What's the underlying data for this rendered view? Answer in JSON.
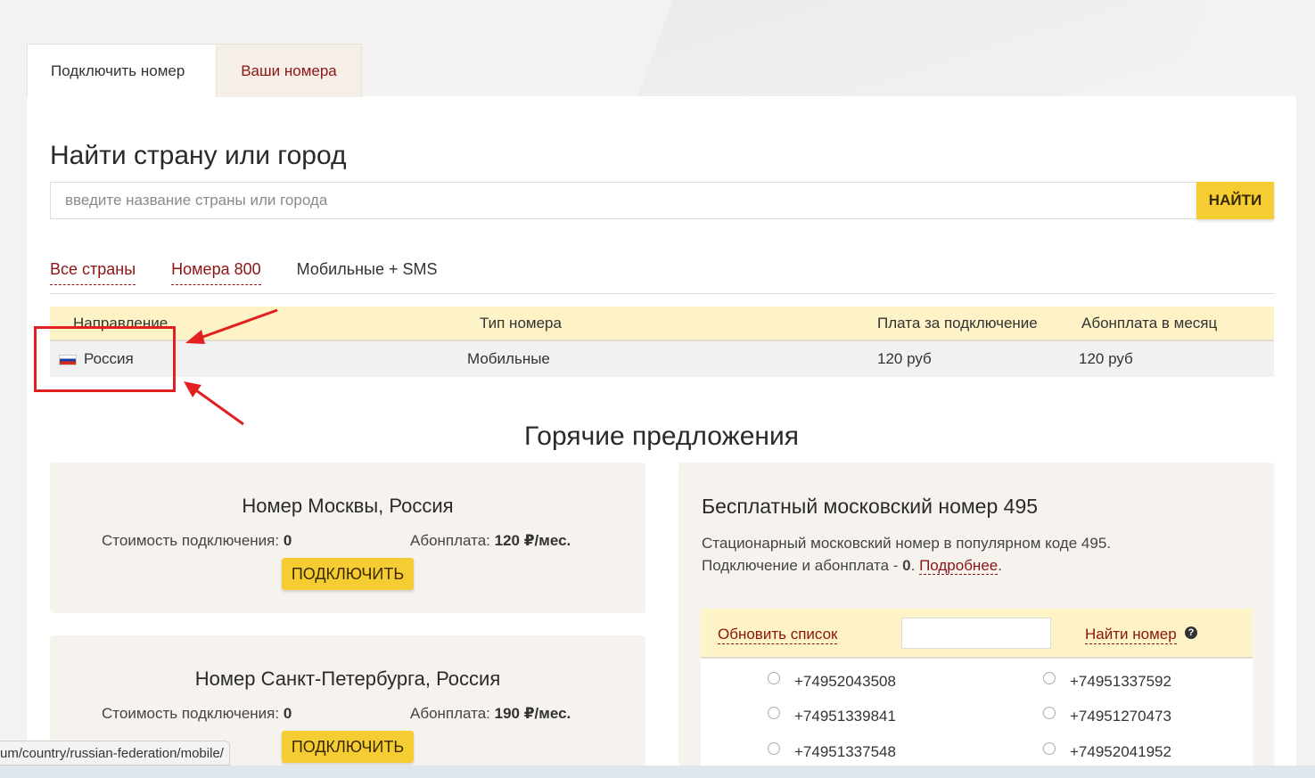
{
  "tabs": {
    "connect_label": "Подключить номер",
    "mine_label": "Ваши номера"
  },
  "search": {
    "title": "Найти страну или город",
    "placeholder": "введите название страны или города",
    "button_label": "НАЙТИ"
  },
  "subtabs": [
    "Все страны",
    "Номера 800",
    "Мобильные + SMS"
  ],
  "table": {
    "headers": [
      "Направление",
      "Тип номера",
      "Плата за подключение",
      "Абонплата в месяц"
    ],
    "rows": [
      {
        "direction": "Россия",
        "type": "Мобильные",
        "connect_fee": "120 руб",
        "monthly_fee": "120 руб"
      }
    ]
  },
  "hot": {
    "title": "Горячие предложения",
    "cards": [
      {
        "title": "Номер Москвы, Россия",
        "connect_label": "Стоимость подключения:",
        "connect_value": "0",
        "fee_label": "Абонплата:",
        "fee_value": "120 ₽/мес.",
        "button": "ПОДКЛЮЧИТЬ"
      },
      {
        "title": "Номер Санкт-Петербурга, Россия",
        "connect_label": "Стоимость подключения:",
        "connect_value": "0",
        "fee_label": "Абонплата:",
        "fee_value": "190 ₽/мес.",
        "button": "ПОДКЛЮЧИТЬ"
      }
    ],
    "free": {
      "title": "Бесплатный московский номер 495",
      "desc1": "Стационарный московский номер в популярном коде 495.",
      "desc2_prefix": "Подключение и абонплата - ",
      "desc2_bold": "0",
      "desc2_sep": ". ",
      "more_link": "Подробнее",
      "desc2_end": ".",
      "refresh": "Обновить список",
      "find": "Найти номер",
      "numbers": [
        "+74952043508",
        "+74951337592",
        "+74951339841",
        "+74951270473",
        "+74951337548",
        "+74952041952"
      ]
    }
  },
  "status_url": "um/country/russian-federation/mobile/",
  "colors": {
    "accent": "#f5cd33",
    "link": "#8b1414",
    "highlight": "#e32020"
  }
}
